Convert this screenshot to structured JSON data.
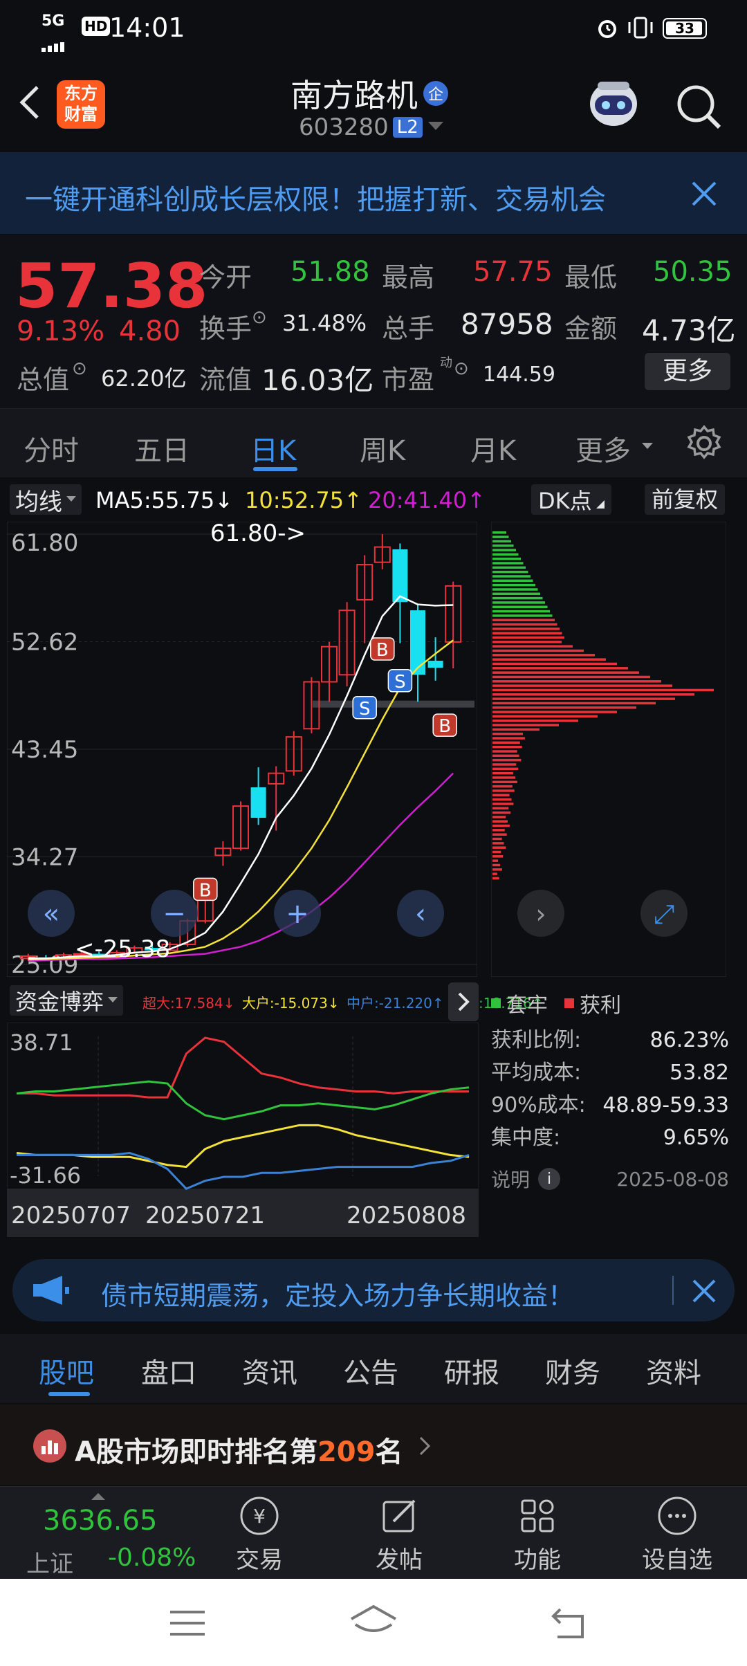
{
  "status": {
    "network": "5G",
    "hd": "HD",
    "time": "14:01",
    "battery": "33"
  },
  "header": {
    "title": "南方路机",
    "title_badge": "企",
    "code": "603280",
    "level": "L2",
    "logo_line1": "东方",
    "logo_line2": "财富"
  },
  "banner": {
    "text": "一键开通科创成长层权限！把握打新、交易机会"
  },
  "quote": {
    "price": "57.38",
    "change_pct": "9.13%",
    "change": "4.80",
    "open_label": "今开",
    "open": "51.88",
    "high_label": "最高",
    "high": "57.75",
    "low_label": "最低",
    "low": "50.35",
    "turnover_label": "换手",
    "turnover": "31.48%",
    "volume_label": "总手",
    "volume": "87958",
    "amount_label": "金额",
    "amount": "4.73亿",
    "mktcap_label": "总值",
    "mktcap": "62.20亿",
    "float_label": "流值",
    "float_cap": "16.03亿",
    "pe_label": "市盈",
    "pe_sup": "动",
    "pe": "144.59",
    "more": "更多"
  },
  "tabs": [
    "分时",
    "五日",
    "日K",
    "周K",
    "月K",
    "更多"
  ],
  "chart_controls": {
    "indicator": "均线",
    "ma5": "MA5:55.75",
    "ma10": "10:52.75",
    "ma20": "20:41.40",
    "dk": "DK点",
    "adjust": "前复权"
  },
  "chart_data": [
    {
      "type": "candlestick",
      "y_ticks": [
        "61.80",
        "52.62",
        "43.45",
        "34.27",
        "25.09"
      ],
      "ylim": [
        25.09,
        61.8
      ],
      "high_annotation": "61.80->",
      "low_annotation": "<-25.38",
      "candles": [
        {
          "o": 25.6,
          "c": 25.8,
          "h": 26.0,
          "l": 25.4,
          "up": true
        },
        {
          "o": 25.7,
          "c": 25.5,
          "h": 25.9,
          "l": 25.38,
          "up": false
        },
        {
          "o": 25.6,
          "c": 25.9,
          "h": 26.1,
          "l": 25.5,
          "up": true
        },
        {
          "o": 25.9,
          "c": 26.0,
          "h": 26.2,
          "l": 25.7,
          "up": true
        },
        {
          "o": 26.0,
          "c": 25.8,
          "h": 26.2,
          "l": 25.6,
          "up": false
        },
        {
          "o": 25.8,
          "c": 26.1,
          "h": 26.3,
          "l": 25.7,
          "up": true
        },
        {
          "o": 26.1,
          "c": 26.5,
          "h": 26.7,
          "l": 26.0,
          "up": true
        },
        {
          "o": 26.5,
          "c": 26.3,
          "h": 26.8,
          "l": 26.1,
          "up": false
        },
        {
          "o": 26.3,
          "c": 26.8,
          "h": 27.0,
          "l": 26.2,
          "up": true
        },
        {
          "o": 26.8,
          "c": 28.8,
          "h": 29.0,
          "l": 26.6,
          "up": true
        },
        {
          "o": 28.8,
          "c": 30.6,
          "h": 31.0,
          "l": 28.6,
          "up": true
        },
        {
          "o": 34.4,
          "c": 35.0,
          "h": 35.6,
          "l": 33.5,
          "up": true
        },
        {
          "o": 35.0,
          "c": 38.6,
          "h": 39.0,
          "l": 34.8,
          "up": true
        },
        {
          "o": 40.2,
          "c": 37.6,
          "h": 41.9,
          "l": 37.0,
          "up": false
        },
        {
          "o": 40.5,
          "c": 41.4,
          "h": 42.0,
          "l": 36.5,
          "up": true
        },
        {
          "o": 41.6,
          "c": 44.5,
          "h": 45.0,
          "l": 41.2,
          "up": true
        },
        {
          "o": 45.2,
          "c": 49.2,
          "h": 49.6,
          "l": 44.8,
          "up": true
        },
        {
          "o": 49.2,
          "c": 52.2,
          "h": 52.6,
          "l": 47.5,
          "up": true
        },
        {
          "o": 49.8,
          "c": 55.3,
          "h": 56.0,
          "l": 48.8,
          "up": true
        },
        {
          "o": 56.2,
          "c": 59.2,
          "h": 60.0,
          "l": 52.5,
          "up": true
        },
        {
          "o": 60.7,
          "c": 59.4,
          "h": 61.8,
          "l": 58.8,
          "up": true
        },
        {
          "o": 56.0,
          "c": 60.5,
          "h": 61.0,
          "l": 52.5,
          "up": false
        },
        {
          "o": 55.3,
          "c": 49.8,
          "h": 55.8,
          "l": 47.5,
          "up": false
        },
        {
          "o": 51.0,
          "c": 50.4,
          "h": 53.0,
          "l": 49.3,
          "up": false
        },
        {
          "o": 52.6,
          "c": 57.38,
          "h": 57.75,
          "l": 50.35,
          "up": true
        }
      ],
      "ma5": [
        25.6,
        25.6,
        25.7,
        25.8,
        25.8,
        25.9,
        26.1,
        26.2,
        26.4,
        27.0,
        27.8,
        29.6,
        32.0,
        34.5,
        37.6,
        39.5,
        41.8,
        44.7,
        48.0,
        51.5,
        54.8,
        56.5,
        55.8,
        55.7,
        55.75
      ],
      "ma10": [
        25.5,
        25.55,
        25.6,
        25.65,
        25.7,
        25.75,
        25.85,
        25.95,
        26.05,
        26.3,
        26.6,
        27.3,
        28.3,
        29.6,
        31.2,
        33.0,
        35.0,
        37.4,
        40.2,
        43.1,
        46.0,
        48.7,
        50.4,
        51.6,
        52.75
      ],
      "ma20": [
        25.4,
        25.45,
        25.5,
        25.55,
        25.55,
        25.6,
        25.65,
        25.7,
        25.8,
        25.9,
        26.0,
        26.3,
        26.6,
        27.1,
        27.8,
        28.6,
        29.6,
        30.8,
        32.2,
        33.8,
        35.4,
        37.0,
        38.5,
        39.9,
        41.4
      ]
    },
    {
      "type": "line",
      "title": "资金博弈",
      "legend": [
        {
          "name": "超大",
          "value": "17.584",
          "dir": "↓",
          "color": "#e8333a"
        },
        {
          "name": "大户",
          "value": "-15.073",
          "dir": "↓",
          "color": "#f4e23a"
        },
        {
          "name": "中户",
          "value": "-21.220",
          "dir": "↑",
          "color": "#3b82d6"
        },
        {
          "name": "小户",
          "value": "18.716",
          "dir": "↑",
          "color": "#31c23e"
        }
      ],
      "y_ticks": [
        "38.71",
        "-31.66"
      ],
      "ylim": [
        -31.66,
        38.71
      ],
      "x_ticks": [
        "20250707",
        "20250721",
        "20250808"
      ],
      "series": [
        {
          "name": "超大",
          "color": "#e8333a",
          "values": [
            10,
            10,
            9,
            9,
            9,
            9,
            9,
            8,
            8,
            30,
            38,
            36,
            28,
            20,
            18,
            15,
            13,
            12,
            11,
            11,
            10,
            11,
            11,
            11,
            11
          ]
        },
        {
          "name": "大户",
          "color": "#f4e23a",
          "values": [
            -20,
            -21,
            -21,
            -21,
            -22,
            -22,
            -22,
            -24,
            -26,
            -27,
            -18,
            -14,
            -12,
            -10,
            -8,
            -6,
            -6,
            -8,
            -11,
            -13,
            -15,
            -17,
            -19,
            -21,
            -22
          ]
        },
        {
          "name": "中户",
          "color": "#3b82d6",
          "values": [
            -21,
            -21,
            -21,
            -21,
            -21,
            -21,
            -20,
            -23,
            -28,
            -38,
            -34,
            -32,
            -32,
            -30,
            -30,
            -29,
            -28,
            -27,
            -27,
            -27,
            -27,
            -27,
            -25,
            -24,
            -21
          ]
        },
        {
          "name": "小户",
          "color": "#31c23e",
          "values": [
            10,
            11,
            11,
            12,
            13,
            14,
            15,
            16,
            15,
            5,
            -1,
            -3,
            -1,
            1,
            4,
            4,
            5,
            4,
            3,
            2,
            4,
            7,
            10,
            12,
            13
          ]
        }
      ]
    }
  ],
  "chip": {
    "legend_hold": "套牢",
    "legend_profit": "获利",
    "rows": [
      {
        "label": "获利比例:",
        "value": "86.23%"
      },
      {
        "label": "平均成本:",
        "value": "53.82"
      },
      {
        "label": "90%成本:",
        "value": "48.89-59.33"
      },
      {
        "label": "集中度:",
        "value": "9.65%"
      }
    ],
    "note": "说明",
    "date": "2025-08-08"
  },
  "ad": {
    "text": "债市短期震荡，定投入场力争长期收益！"
  },
  "bottom_tabs": [
    "股吧",
    "盘口",
    "资讯",
    "公告",
    "研报",
    "财务",
    "资料"
  ],
  "rank": {
    "prefix": "A股市场即时排名第",
    "number": "209",
    "suffix": "名"
  },
  "bottom_nav": {
    "index_value": "3636.65",
    "index_name": "上证",
    "index_change": "-0.08%",
    "items": [
      "交易",
      "发帖",
      "功能",
      "设自选"
    ]
  },
  "colors": {
    "up": "#e8333a",
    "down": "#31c23e",
    "accent": "#3b8fe8",
    "cyan": "#19e0f0"
  }
}
